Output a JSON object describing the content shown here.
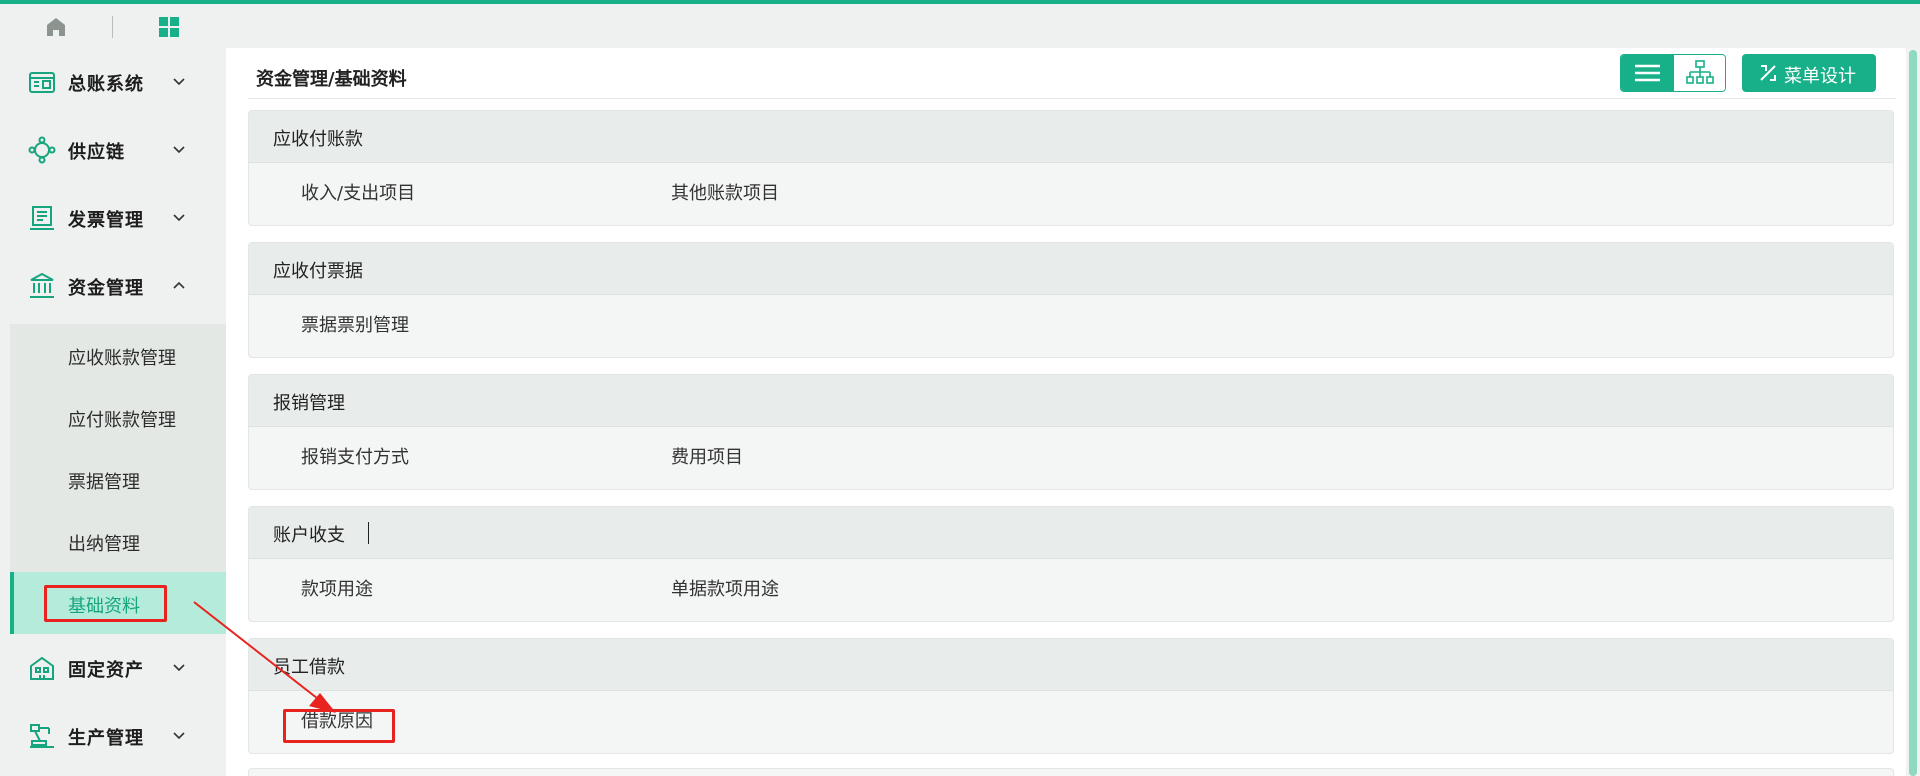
{
  "colors": {
    "accent": "#17b089",
    "highlight": "#e8231f",
    "active_bg": "#b4ebda"
  },
  "topbar": {
    "home_icon": "home-icon",
    "apps_icon": "grid-icon"
  },
  "sidebar": {
    "items": [
      {
        "label": "总账系统",
        "icon": "ledger-icon",
        "expanded": false
      },
      {
        "label": "供应链",
        "icon": "supply-chain-icon",
        "expanded": false
      },
      {
        "label": "发票管理",
        "icon": "invoice-icon",
        "expanded": false
      },
      {
        "label": "资金管理",
        "icon": "bank-icon",
        "expanded": true
      },
      {
        "label": "固定资产",
        "icon": "building-icon",
        "expanded": false
      },
      {
        "label": "生产管理",
        "icon": "robot-arm-icon",
        "expanded": false
      }
    ],
    "sub_items": [
      {
        "label": "应收账款管理"
      },
      {
        "label": "应付账款管理"
      },
      {
        "label": "票据管理"
      },
      {
        "label": "出纳管理"
      },
      {
        "label": "基础资料",
        "active": true
      }
    ]
  },
  "main": {
    "breadcrumb": "资金管理/基础资料",
    "menu_design_label": "菜单设计",
    "sections": [
      {
        "title": "应收付账款",
        "items": [
          "收入/支出项目",
          "其他账款项目"
        ]
      },
      {
        "title": "应收付票据",
        "items": [
          "票据票别管理"
        ]
      },
      {
        "title": "报销管理",
        "items": [
          "报销支付方式",
          "费用项目"
        ]
      },
      {
        "title": "账户收支",
        "items": [
          "款项用途",
          "单据款项用途"
        ]
      },
      {
        "title": "员工借款",
        "items": [
          "借款原因"
        ]
      }
    ]
  }
}
